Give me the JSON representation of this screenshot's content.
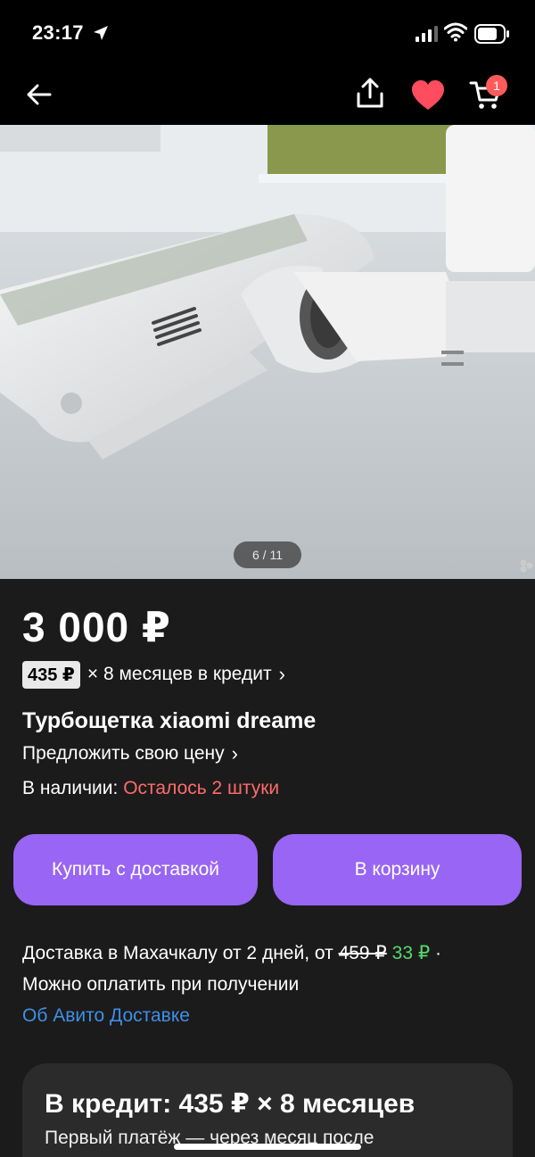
{
  "status_bar": {
    "time": "23:17"
  },
  "nav": {
    "cart_count": "1"
  },
  "gallery": {
    "counter": "6 / 11"
  },
  "product": {
    "price": "3 000 ₽",
    "credit_amount": "435 ₽",
    "credit_text": "× 8 месяцев в кредит",
    "title": "Турбощетка xiaomi dreame",
    "offer_price": "Предложить свою цену",
    "stock_label": "В наличии:",
    "stock_status": "Осталось 2 штуки"
  },
  "buttons": {
    "buy_with_delivery": "Купить с доставкой",
    "add_to_cart": "В корзину"
  },
  "delivery": {
    "text": "Доставка в Махачкалу от 2 дней, от",
    "old_price": "459 ₽",
    "new_price": "33 ₽",
    "separator": "·",
    "payment": "Можно оплатить при получении",
    "link": "Об Авито Доставке"
  },
  "credit_card": {
    "title": "В кредит: 435 ₽ × 8 месяцев",
    "subtitle": "Первый платёж — через месяц после"
  },
  "colors": {
    "accent": "#9965f4",
    "stock_red": "#ff6b6b",
    "price_green": "#58d96b",
    "link_blue": "#3f8fe6",
    "heart_red": "#ff4c5e"
  }
}
